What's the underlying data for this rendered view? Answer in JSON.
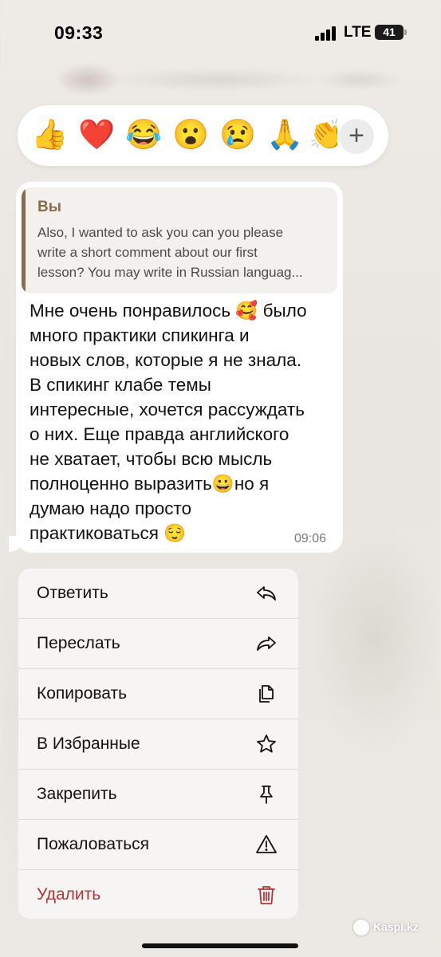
{
  "status_bar": {
    "time": "09:33",
    "network": "LTE",
    "battery": "41"
  },
  "reactions": {
    "items": [
      "👍",
      "❤️",
      "😂",
      "😮",
      "😢",
      "🙏",
      "👏"
    ],
    "add_label": "+"
  },
  "message": {
    "reply": {
      "author": "Вы",
      "text": "Also, I wanted to ask you can you please\nwrite a short comment about our first\nlesson? You may write in Russian languag..."
    },
    "text": "Мне очень понравилось 🥰 было\nмного практики спикинга и\nновых слов, которые я не знала.\nВ спикинг клабе темы\nинтересные, хочется рассуждать\nо них. Еще правда английского\nне хватает, чтобы всю мысль\nполноценно выразить😀но я\nдумаю надо просто\nпрактиковаться 😌",
    "time": "09:06"
  },
  "menu": {
    "items": [
      {
        "label": "Ответить",
        "icon": "reply-icon"
      },
      {
        "label": "Переслать",
        "icon": "forward-icon"
      },
      {
        "label": "Копировать",
        "icon": "copy-icon"
      },
      {
        "label": "В Избранные",
        "icon": "star-icon"
      },
      {
        "label": "Закрепить",
        "icon": "pin-icon"
      },
      {
        "label": "Пожаловаться",
        "icon": "warning-icon"
      },
      {
        "label": "Удалить",
        "icon": "trash-icon",
        "color": "#b63535"
      }
    ]
  },
  "watermark": "Kaspi.kz",
  "colors": {
    "accent_quote": "#8b6a4b",
    "danger": "#b63535",
    "background": "#ebe8e3"
  }
}
